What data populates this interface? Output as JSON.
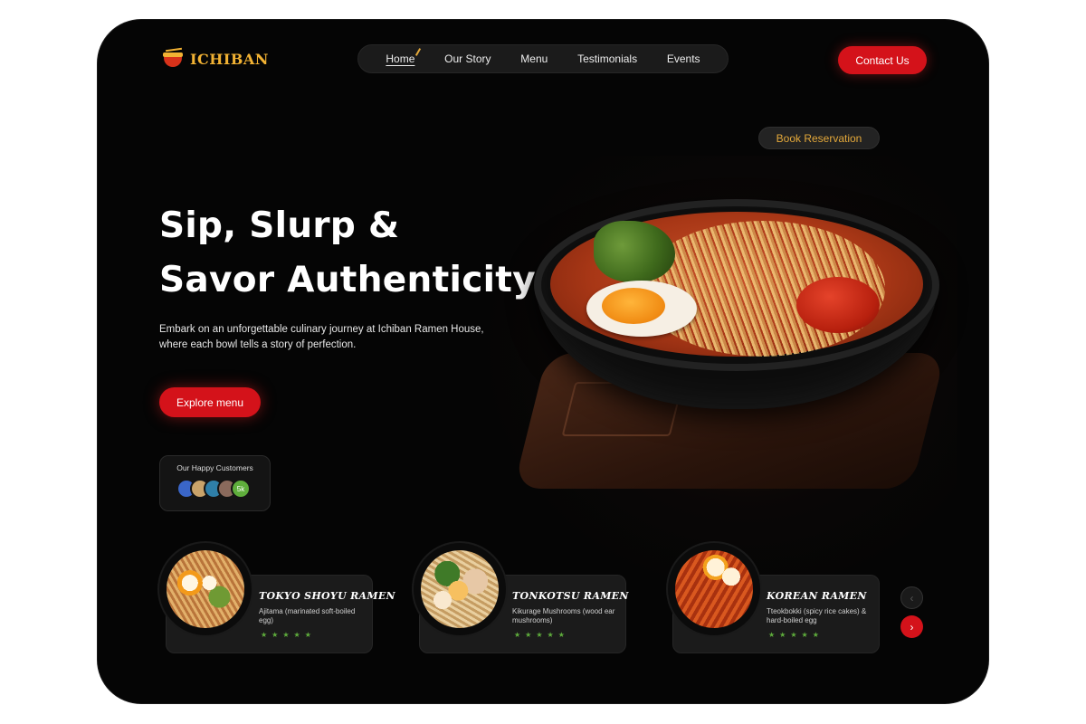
{
  "brand": {
    "name": "ICHIBAN",
    "accent": "#d4121a",
    "gold": "#e3a83a"
  },
  "nav": {
    "items": [
      {
        "label": "Home",
        "active": true
      },
      {
        "label": "Our Story",
        "active": false
      },
      {
        "label": "Menu",
        "active": false
      },
      {
        "label": "Testimonials",
        "active": false
      },
      {
        "label": "Events",
        "active": false
      }
    ]
  },
  "header": {
    "contact_label": "Contact Us"
  },
  "reservation": {
    "label": "Book Reservation"
  },
  "hero": {
    "title_line1": "Sip, Slurp &",
    "title_line2": "Savor Authenticity",
    "subtitle": "Embark on an unforgettable culinary journey at Ichiban Ramen House, where each bowl tells a story of perfection.",
    "cta_label": "Explore menu"
  },
  "customers": {
    "label": "Our Happy Customers",
    "count": "5k",
    "avatar_colors": [
      "#3a66c8",
      "#c9a36a",
      "#2f7fa8",
      "#8a6a5c"
    ]
  },
  "dishes": [
    {
      "name": "TOKYO SHOYU RAMEN",
      "desc": "Ajitama (marinated soft-boiled egg)",
      "rating": 5
    },
    {
      "name": "TONKOTSU RAMEN",
      "desc": "Kikurage Mushrooms (wood ear mushrooms)",
      "rating": 5
    },
    {
      "name": "KOREAN RAMEN",
      "desc": "Tteokbokki (spicy rice cakes) & hard-boiled egg",
      "rating": 5
    }
  ],
  "carousel": {
    "prev_icon": "chevron-left-icon",
    "next_icon": "chevron-right-icon"
  }
}
